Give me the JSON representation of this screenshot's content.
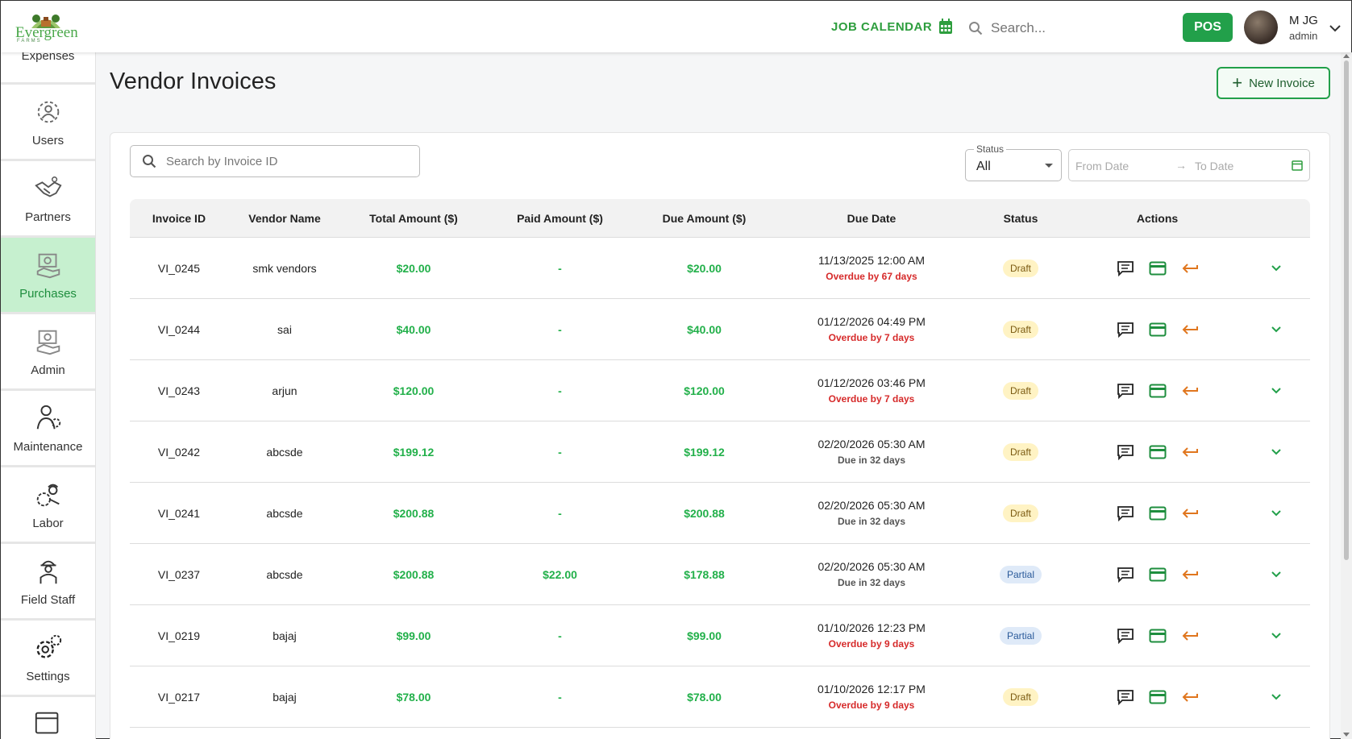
{
  "brand": {
    "name": "Evergreen",
    "sub": "FARMS"
  },
  "header": {
    "job_calendar": "JOB CALENDAR",
    "search_placeholder": "Search...",
    "pos": "POS",
    "user_name": "M JG",
    "user_role": "admin"
  },
  "sidebar": {
    "partial_item": "Expenses",
    "items": [
      {
        "label": "Users",
        "icon": "users-gear-icon",
        "active": false
      },
      {
        "label": "Partners",
        "icon": "handshake-icon",
        "active": false
      },
      {
        "label": "Purchases",
        "icon": "purchases-icon",
        "active": true
      },
      {
        "label": "Admin",
        "icon": "admin-icon",
        "active": false
      },
      {
        "label": "Maintenance",
        "icon": "maintenance-icon",
        "active": false
      },
      {
        "label": "Labor",
        "icon": "labor-icon",
        "active": false
      },
      {
        "label": "Field Staff",
        "icon": "field-staff-icon",
        "active": false
      },
      {
        "label": "Settings",
        "icon": "settings-icon",
        "active": false
      }
    ]
  },
  "page": {
    "title": "Vendor Invoices",
    "new_invoice": "New Invoice"
  },
  "filters": {
    "search_placeholder": "Search by Invoice ID",
    "status_label": "Status",
    "status_value": "All",
    "from_date": "From Date",
    "to_date": "To Date"
  },
  "table": {
    "headers": [
      "Invoice ID",
      "Vendor Name",
      "Total Amount ($)",
      "Paid Amount ($)",
      "Due Amount ($)",
      "Due Date",
      "Status",
      "Actions"
    ],
    "rows": [
      {
        "id": "VI_0245",
        "vendor": "smk vendors",
        "total": "$20.00",
        "paid": "-",
        "due": "$20.00",
        "due_date": "11/13/2025 12:00 AM",
        "due_note": "Overdue by 67 days",
        "overdue": true,
        "status": "Draft"
      },
      {
        "id": "VI_0244",
        "vendor": "sai",
        "total": "$40.00",
        "paid": "-",
        "due": "$40.00",
        "due_date": "01/12/2026 04:49 PM",
        "due_note": "Overdue by 7 days",
        "overdue": true,
        "status": "Draft"
      },
      {
        "id": "VI_0243",
        "vendor": "arjun",
        "total": "$120.00",
        "paid": "-",
        "due": "$120.00",
        "due_date": "01/12/2026 03:46 PM",
        "due_note": "Overdue by 7 days",
        "overdue": true,
        "status": "Draft"
      },
      {
        "id": "VI_0242",
        "vendor": "abcsde",
        "total": "$199.12",
        "paid": "-",
        "due": "$199.12",
        "due_date": "02/20/2026 05:30 AM",
        "due_note": "Due in 32 days",
        "overdue": false,
        "status": "Draft"
      },
      {
        "id": "VI_0241",
        "vendor": "abcsde",
        "total": "$200.88",
        "paid": "-",
        "due": "$200.88",
        "due_date": "02/20/2026 05:30 AM",
        "due_note": "Due in 32 days",
        "overdue": false,
        "status": "Draft"
      },
      {
        "id": "VI_0237",
        "vendor": "abcsde",
        "total": "$200.88",
        "paid": "$22.00",
        "due": "$178.88",
        "due_date": "02/20/2026 05:30 AM",
        "due_note": "Due in 32 days",
        "overdue": false,
        "status": "Partial"
      },
      {
        "id": "VI_0219",
        "vendor": "bajaj",
        "total": "$99.00",
        "paid": "-",
        "due": "$99.00",
        "due_date": "01/10/2026 12:23 PM",
        "due_note": "Overdue by 9 days",
        "overdue": true,
        "status": "Partial"
      },
      {
        "id": "VI_0217",
        "vendor": "bajaj",
        "total": "$78.00",
        "paid": "-",
        "due": "$78.00",
        "due_date": "01/10/2026 12:17 PM",
        "due_note": "Overdue by 9 days",
        "overdue": true,
        "status": "Draft"
      }
    ]
  },
  "colors": {
    "accent": "#22a04a",
    "overdue": "#d62a2a",
    "active_nav": "#c6f0cf"
  }
}
